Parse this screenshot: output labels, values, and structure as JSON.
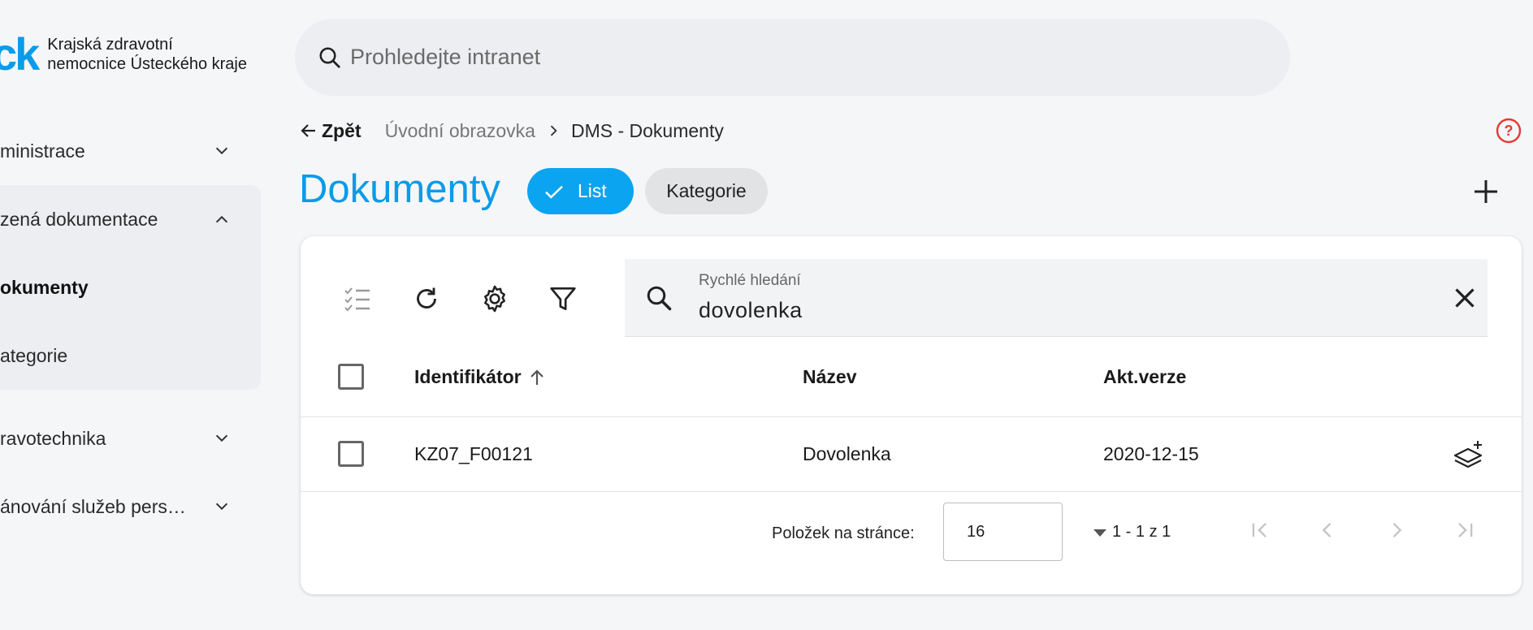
{
  "sidebar": {
    "logo_mark": "ck",
    "logo_line1": "Krajská zdravotní",
    "logo_line2": "nemocnice Ústeckého kraje",
    "items": [
      {
        "label": "ministrace"
      },
      {
        "label": "zená dokumentace"
      },
      {
        "label": "ravotechnika"
      },
      {
        "label": "ánování služeb pers…"
      }
    ],
    "subitems": [
      {
        "label": "okumenty"
      },
      {
        "label": "ategorie"
      }
    ]
  },
  "search": {
    "placeholder": "Prohledejte intranet"
  },
  "breadcrumb": {
    "back_label": "Zpět",
    "home": "Úvodní obrazovka",
    "current": "DMS - Dokumenty"
  },
  "page": {
    "title": "Dokumenty",
    "chip_list": "List",
    "chip_categories": "Kategorie"
  },
  "quick_search": {
    "label": "Rychlé hledání",
    "value": "dovolenka"
  },
  "table": {
    "columns": [
      "Identifikátor",
      "Název",
      "Akt.verze"
    ],
    "rows": [
      {
        "id": "KZ07_F00121",
        "name": "Dovolenka",
        "version": "2020-12-15"
      }
    ]
  },
  "pager": {
    "label": "Položek na stránce:",
    "page_size": "16",
    "range": "1 - 1 z 1"
  },
  "colors": {
    "accent": "#0b9be8",
    "help": "#e53935"
  }
}
